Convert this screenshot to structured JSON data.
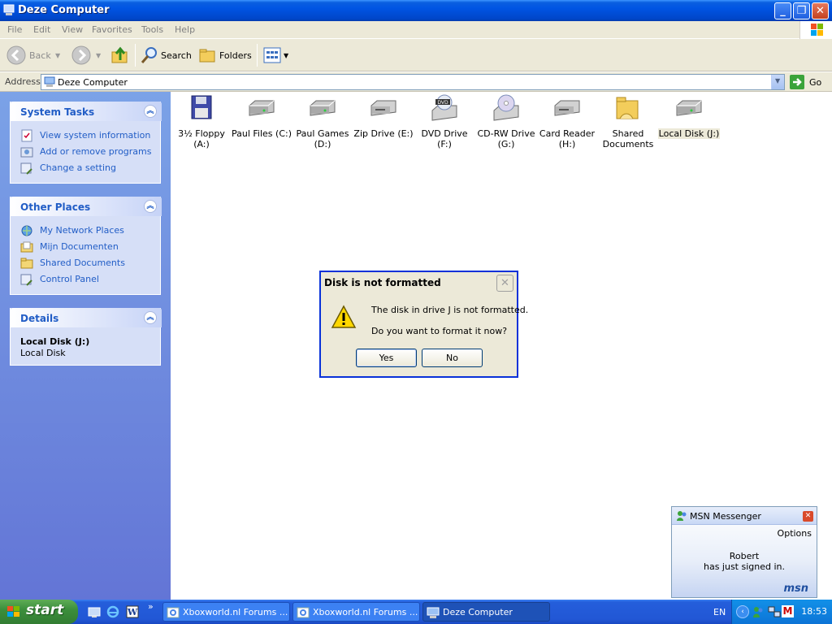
{
  "window": {
    "title": "Deze Computer",
    "colors": {
      "titlebar": "#0054e3",
      "taskpane": "#6375d6",
      "link": "#215dc6"
    }
  },
  "menubar": {
    "items": [
      "File",
      "Edit",
      "View",
      "Favorites",
      "Tools",
      "Help"
    ]
  },
  "toolbar": {
    "back_label": "Back",
    "search_label": "Search",
    "folders_label": "Folders"
  },
  "address": {
    "label": "Address",
    "value": "Deze Computer",
    "go_label": "Go"
  },
  "taskpane": {
    "system_tasks": {
      "title": "System Tasks",
      "items": [
        "View system information",
        "Add or remove programs",
        "Change a setting"
      ]
    },
    "other_places": {
      "title": "Other Places",
      "items": [
        "My Network Places",
        "Mijn Documenten",
        "Shared Documents",
        "Control Panel"
      ]
    },
    "details": {
      "title": "Details",
      "name": "Local Disk (J:)",
      "type": "Local Disk"
    }
  },
  "drives": [
    {
      "label": "3½ Floppy (A:)",
      "icon": "floppy-icon"
    },
    {
      "label": "Paul Files (C:)",
      "icon": "hard-disk-icon"
    },
    {
      "label": "Paul Games (D:)",
      "icon": "hard-disk-icon"
    },
    {
      "label": "Zip Drive (E:)",
      "icon": "removable-drive-icon"
    },
    {
      "label": "DVD Drive (F:)",
      "icon": "dvd-drive-icon"
    },
    {
      "label": "CD-RW Drive (G:)",
      "icon": "cd-drive-icon"
    },
    {
      "label": "Card Reader (H:)",
      "icon": "removable-drive-icon"
    },
    {
      "label": "Shared Documents",
      "icon": "folder-icon"
    },
    {
      "label": "Local Disk (J:)",
      "icon": "hard-disk-icon"
    }
  ],
  "dialog": {
    "title": "Disk is not formatted",
    "message1": "The disk in drive J is not formatted.",
    "message2": "Do you want to format it now?",
    "yes_label": "Yes",
    "no_label": "No"
  },
  "msn": {
    "title": "MSN Messenger",
    "options_label": "Options",
    "contact": "Robert",
    "message": "has just signed in.",
    "brand": "msn"
  },
  "taskbar": {
    "start_label": "start",
    "tasks": [
      "Xboxworld.nl Forums ...",
      "Xboxworld.nl Forums ...",
      "Deze Computer"
    ],
    "language": "EN",
    "clock": "18:53"
  }
}
